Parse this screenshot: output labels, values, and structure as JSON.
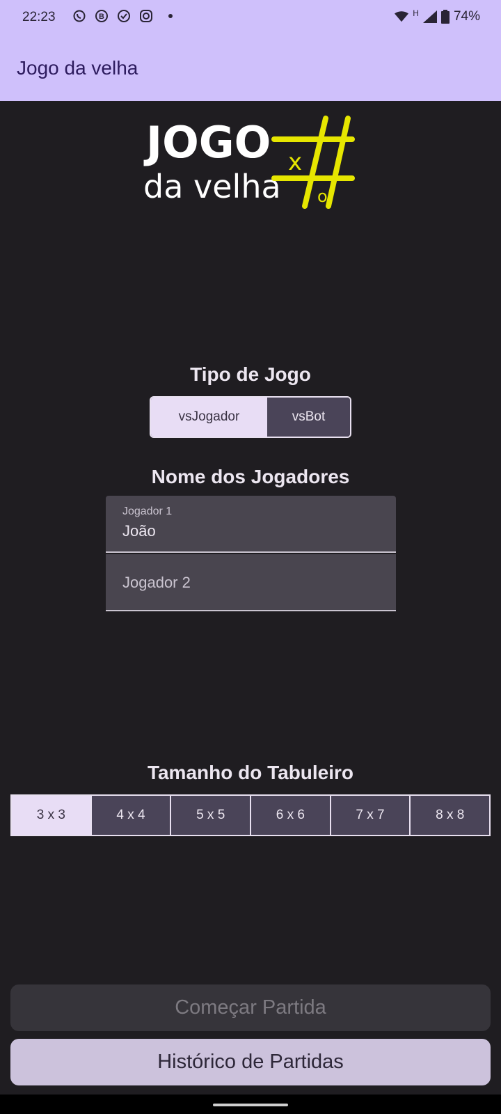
{
  "status_bar": {
    "time": "22:23",
    "icons_left": [
      "whatsapp-icon",
      "b-badge-icon",
      "check-circle-icon",
      "instagram-icon"
    ],
    "icons_right": [
      "wifi-icon",
      "signal-icon",
      "battery-icon"
    ],
    "network_letter": "H",
    "battery": "74%"
  },
  "app_bar": {
    "title": "Jogo da velha"
  },
  "logo": {
    "line1": "JOGO",
    "line2": "da velha",
    "x_mark": "x",
    "o_mark": "o",
    "accent": "#e6e600"
  },
  "game_type": {
    "title": "Tipo de Jogo",
    "options": [
      "vsJogador",
      "vsBot"
    ],
    "selected": "vsJogador"
  },
  "players": {
    "title": "Nome dos Jogadores",
    "player1": {
      "label": "Jogador 1",
      "value": "João"
    },
    "player2": {
      "placeholder": "Jogador 2",
      "value": ""
    }
  },
  "board": {
    "title": "Tamanho do Tabuleiro",
    "options": [
      "3 x 3",
      "4 x 4",
      "5 x 5",
      "6 x 6",
      "7 x 7",
      "8 x 8"
    ],
    "selected": "3 x 3"
  },
  "actions": {
    "start_label": "Começar Partida",
    "history_label": "Histórico de Partidas"
  },
  "colors": {
    "app_bar": "#cfc0fb",
    "background": "#1f1d21",
    "segment_selected": "#e8ddf5",
    "segment_unselected": "#4a4458"
  }
}
